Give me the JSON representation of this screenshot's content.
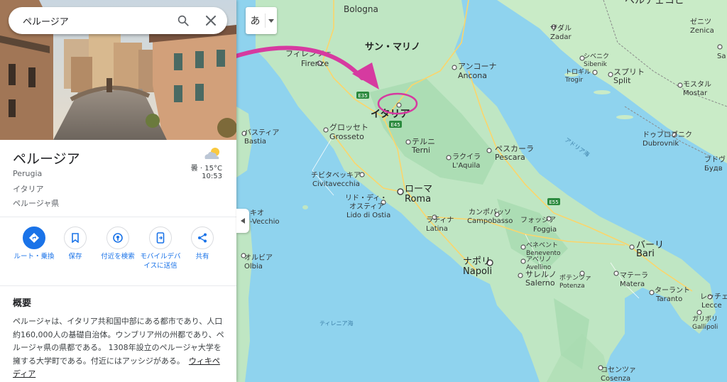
{
  "search": {
    "value": "ペルージア",
    "placeholder": ""
  },
  "place": {
    "title": "ペルージア",
    "latin_name": "Perugia",
    "country": "イタリア",
    "province": "ペルージャ県"
  },
  "weather": {
    "summary": "曇 · 15°C",
    "time": "10:53",
    "icon": "partly-cloudy-icon"
  },
  "actions": [
    {
      "label": "ルート・乗換",
      "icon": "directions-icon"
    },
    {
      "label": "保存",
      "icon": "bookmark-icon"
    },
    {
      "label": "付近を検索",
      "icon": "nearby-icon"
    },
    {
      "label": "モバイルデバイスに送信",
      "icon": "send-to-phone-icon"
    },
    {
      "label": "共有",
      "icon": "share-icon"
    }
  ],
  "overview": {
    "title": "概要",
    "body": "ペルージャは、イタリア共和国中部にある都市であり、人口約160,000人の基礎自治体。ウンブリア州の州都であり、ペルージャ県の県都である。 1308年設立のペルージャ大学を擁する大学町である。付近にはアッシジがある。",
    "link": "ウィキペディア"
  },
  "map": {
    "lang_button": "あ",
    "countries": {
      "italy": "イタリア",
      "czech": "ベルチェコピ",
      "san_marino": "サン・マリノ"
    },
    "seas": {
      "adriatic": "アドリア海",
      "tyrrhenian": "ティレニア海"
    },
    "highways": [
      "E35",
      "E45",
      "E55"
    ],
    "cities": {
      "bologna": "Bologna",
      "firenze_ja": "フィレンツェ",
      "firenze": "Firenze",
      "ancona_ja": "アンコーナ",
      "ancona": "Ancona",
      "grosseto_ja": "グロッセト",
      "grosseto": "Grosseto",
      "terni_ja": "テルニ",
      "terni": "Terni",
      "pescara_ja": "ペスカーラ",
      "pescara": "Pescara",
      "aquila_ja": "ラクイラ",
      "aquila": "L'Aquila",
      "bastia_ja": "バスティア",
      "bastia": "Bastia",
      "civitavecchia_ja": "チビタベッキア",
      "civitavecchia": "Civitavecchia",
      "roma_ja": "ローマ",
      "roma": "Roma",
      "ostia_ja1": "リド・ディ・",
      "ostia_ja2": "オスティア",
      "ostia": "Lido di Ostia",
      "latina_ja": "ラティナ",
      "latina": "Latina",
      "campobasso_ja": "カンポバッソ",
      "campobasso": "Campobasso",
      "foggia_ja": "フォッジア",
      "foggia": "Foggia",
      "bari_ja": "バーリ",
      "bari": "Bari",
      "napoli_ja": "ナポリ",
      "napoli": "Napoli",
      "benevento_ja": "ベネベント",
      "benevento": "Benevento",
      "avellino_ja": "アベリノ",
      "avellino": "Avellino",
      "salerno_ja": "サレルノ",
      "salerno": "Salerno",
      "potenza_ja": "ポテンツァ",
      "potenza": "Potenza",
      "matera_ja": "マテーラ",
      "matera": "Matera",
      "taranto_ja": "ターラント",
      "taranto": "Taranto",
      "lecce_ja": "レッチェ",
      "lecce": "Lecce",
      "gallipoli_ja": "ガリポリ",
      "gallipoli": "Gallipoli",
      "cosenza_ja": "コセンツァ",
      "cosenza": "Cosenza",
      "olbia_ja": "オルビア",
      "olbia": "Olbia",
      "vecchio_ja": "キオ",
      "vecchio": "-Vecchio",
      "zadar_ja": "ザダル",
      "zadar": "Zadar",
      "sibenik_ja": "シベニク",
      "sibenik": "Sibenik",
      "trogir_ja": "トロギル",
      "trogir": "Trogir",
      "split_ja": "スプリト",
      "split": "Split",
      "mostar_ja": "モスタル",
      "mostar": "Mostar",
      "dubrovnik_ja": "ドゥブロブニク",
      "dubrovnik": "Dubrovnik",
      "zenica_ja": "ゼニツ",
      "zenica": "Zenica",
      "budva_ja": "ブドヴ",
      "budva": "Будв",
      "sarajevo": "Sa"
    }
  },
  "colors": {
    "sea": "#8fd3ee",
    "land": "#bfe6c3",
    "land_dark": "#a7dbb0",
    "accent": "#1a73e8",
    "annotation": "#d63aa0"
  }
}
